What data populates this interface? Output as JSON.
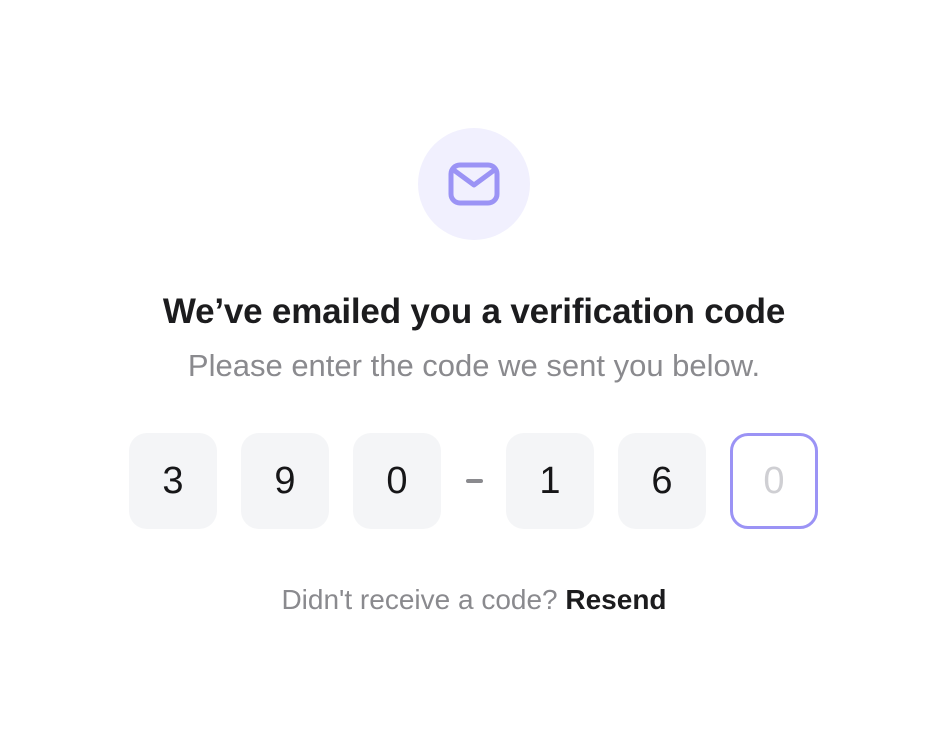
{
  "header": {
    "icon": "mail-icon",
    "title": "We’ve emailed you a verification code",
    "subtitle": "Please enter the code we sent you below."
  },
  "code": {
    "digits": [
      "3",
      "9",
      "0",
      "1",
      "6"
    ],
    "active_placeholder": "0",
    "separator": "-"
  },
  "footer": {
    "prompt": "Didn't receive a code?",
    "resend_label": "Resend"
  },
  "colors": {
    "accent": "#9b93f5",
    "icon_background": "#f1f0fe",
    "box_background": "#f4f5f7"
  }
}
